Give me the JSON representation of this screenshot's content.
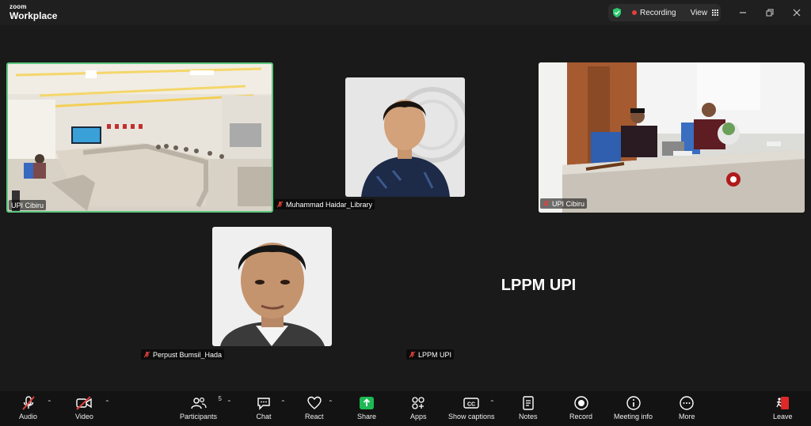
{
  "app": {
    "brand_small": "zoom",
    "brand_large": "Workplace"
  },
  "titlebar": {
    "recording_label": "Recording",
    "view_label": "View"
  },
  "participants": [
    {
      "name": "UPI Cibiru",
      "muted": true,
      "active_speaker": true
    },
    {
      "name": "Muhammad Haidar_Library",
      "muted": true,
      "active_speaker": false
    },
    {
      "name": "UPI Cibiru",
      "muted": true,
      "active_speaker": false
    },
    {
      "name": "Perpust Bumsil_Hada",
      "muted": true,
      "active_speaker": false
    },
    {
      "name": "LPPM UPI",
      "muted": true,
      "active_speaker": false,
      "display_text": "LPPM UPI"
    }
  ],
  "toolbar": {
    "audio": "Audio",
    "video": "Video",
    "participants": "Participants",
    "participants_count": "5",
    "chat": "Chat",
    "react": "React",
    "share": "Share",
    "apps": "Apps",
    "captions": "Show captions",
    "notes": "Notes",
    "record": "Record",
    "meeting_info": "Meeting info",
    "more": "More",
    "leave": "Leave"
  },
  "colors": {
    "accent_green": "#5dc77f",
    "share_green": "#1db954",
    "leave_red": "#e02828",
    "mute_red": "#e0403a"
  }
}
